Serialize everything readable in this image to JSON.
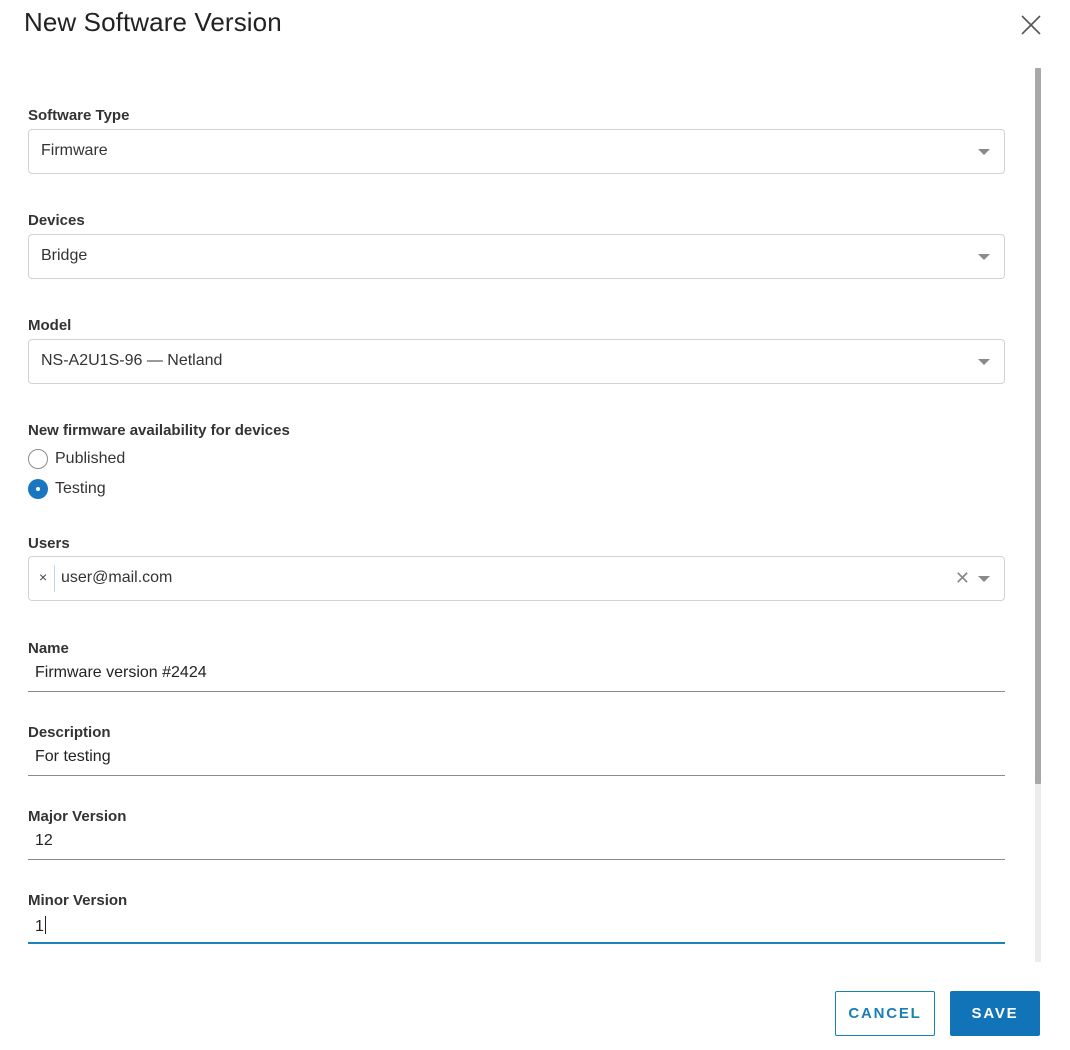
{
  "dialog": {
    "title": "New Software Version"
  },
  "fields": {
    "software_type": {
      "label": "Software Type",
      "value": "Firmware"
    },
    "devices": {
      "label": "Devices",
      "value": "Bridge"
    },
    "model": {
      "label": "Model",
      "value": "NS-A2U1S-96 — Netland"
    },
    "availability": {
      "label": "New firmware availability for devices",
      "options": [
        {
          "label": "Published",
          "checked": false
        },
        {
          "label": "Testing",
          "checked": true
        }
      ]
    },
    "users": {
      "label": "Users",
      "chip": "user@mail.com",
      "chip_remove": "×",
      "clear": "✕"
    },
    "name": {
      "label": "Name",
      "value": "Firmware version #2424"
    },
    "description": {
      "label": "Description",
      "value": "For testing"
    },
    "major_version": {
      "label": "Major Version",
      "value": "12"
    },
    "minor_version": {
      "label": "Minor Version",
      "value": "1"
    }
  },
  "actions": {
    "cancel_label": "CANCEL",
    "save_label": "SAVE"
  },
  "colors": {
    "primary": "#1274b8",
    "radio_checked": "#1976c0",
    "focus_underline": "#1a84b8"
  },
  "icons": {
    "close": "close-icon",
    "dropdown": "chevron-down-icon",
    "clear": "clear-icon"
  }
}
